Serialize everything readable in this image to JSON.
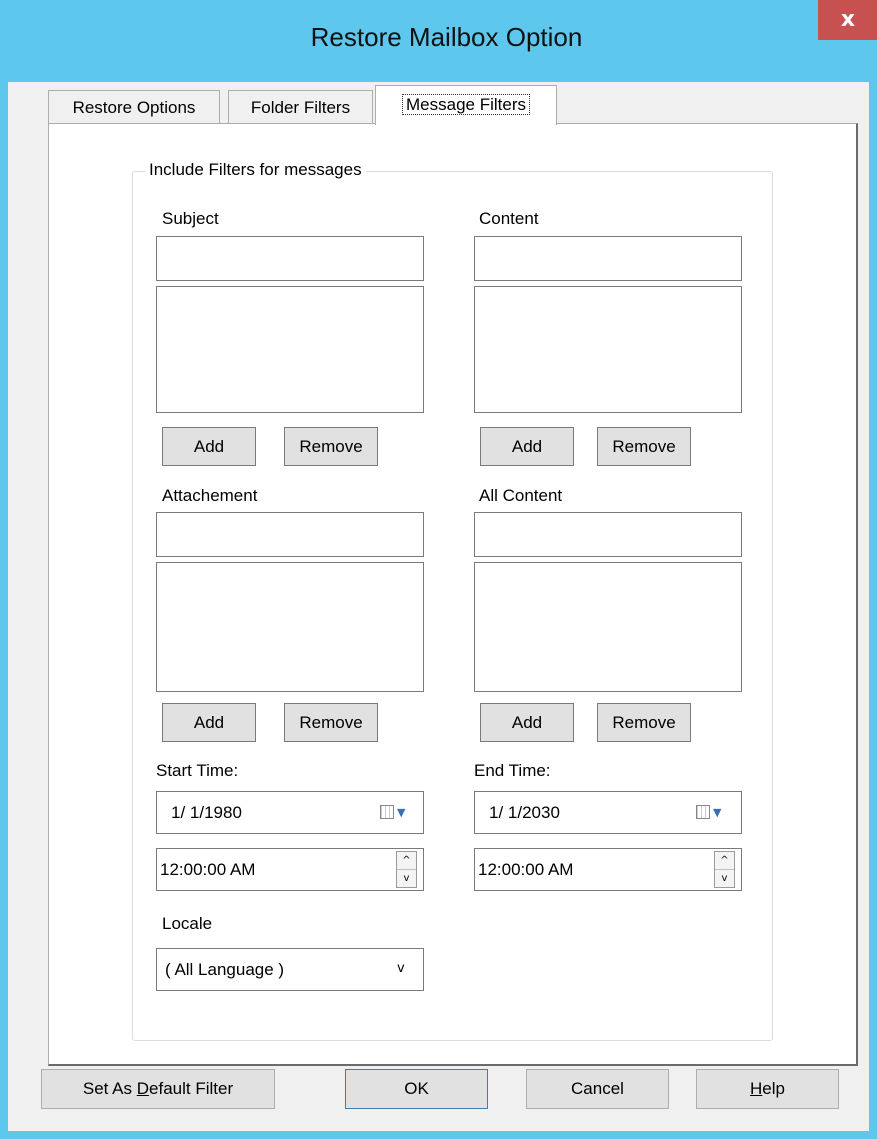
{
  "window": {
    "title": "Restore Mailbox Option",
    "close_glyph": "x"
  },
  "tabs": [
    {
      "label": "Restore Options"
    },
    {
      "label": "Folder Filters"
    },
    {
      "label": "Message Filters",
      "active": true
    }
  ],
  "group": {
    "legend": "Include Filters for messages"
  },
  "filters": {
    "subject": {
      "label": "Subject",
      "input_value": "",
      "add": "Add",
      "remove": "Remove"
    },
    "content": {
      "label": "Content",
      "input_value": "",
      "add": "Add",
      "remove": "Remove"
    },
    "attachment": {
      "label": "Attachement",
      "input_value": "",
      "add": "Add",
      "remove": "Remove"
    },
    "all_content": {
      "label": "All Content",
      "input_value": "",
      "add": "Add",
      "remove": "Remove"
    }
  },
  "start_time": {
    "label": "Start Time:",
    "date": "1/ 1/1980",
    "time": "12:00:00 AM"
  },
  "end_time": {
    "label": "End Time:",
    "date": "1/ 1/2030",
    "time": "12:00:00 AM"
  },
  "locale": {
    "label": "Locale",
    "selected": "( All Language )"
  },
  "buttons": {
    "default_filter_pre": "Set As ",
    "default_filter_key": "D",
    "default_filter_post": "efault Filter",
    "ok": "OK",
    "cancel": "Cancel",
    "help_key": "H",
    "help_post": "elp"
  },
  "colors": {
    "titlebar": "#5ec7ee",
    "close": "#c75050",
    "dropdown_arrow": "#3a6fb0"
  }
}
